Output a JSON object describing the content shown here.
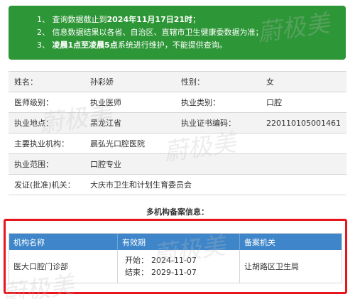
{
  "notice": {
    "line1_prefix": "1、 查询数据截止到",
    "line1_bold": "2024年11月17日21时",
    "line1_suffix": "；",
    "line2": "2、 信息数据结果以各省、自治区、直辖市卫生健康委数据为准；",
    "line3_prefix": "3、 ",
    "line3_bold": "凌晨1点至凌晨5点",
    "line3_suffix": "系统进行维护，不能提供查询。"
  },
  "info": {
    "rows": [
      {
        "label1": "姓名：",
        "value1": "孙彩娇",
        "label2": "性别：",
        "value2": "女"
      },
      {
        "label1": "医师级别：",
        "value1": "执业医师",
        "label2": "执业类别：",
        "value2": "口腔"
      },
      {
        "label1": "执业地点：",
        "value1": "黑龙江省",
        "label2": "执业证书编码：",
        "value2": "220110105001461"
      }
    ],
    "wide_rows": [
      {
        "label": "主要执业机构：",
        "value": "晨弘光口腔医院"
      },
      {
        "label": "执业范围：",
        "value": "口腔专业"
      },
      {
        "label": "发证(批准)机关：",
        "value": "大庆市卫生和计划生育委员会"
      }
    ]
  },
  "registry": {
    "title": "多机构备案信息：",
    "headers": [
      "机构名称",
      "有效期",
      "备案机关"
    ],
    "row": {
      "institution": "医大口腔门诊部",
      "start_label": "开始：",
      "start_date": "2024-11-07",
      "end_label": "结束：",
      "end_date": "2029-11-07",
      "authority": "让胡路区卫生局"
    }
  },
  "watermark": "蔚极美"
}
